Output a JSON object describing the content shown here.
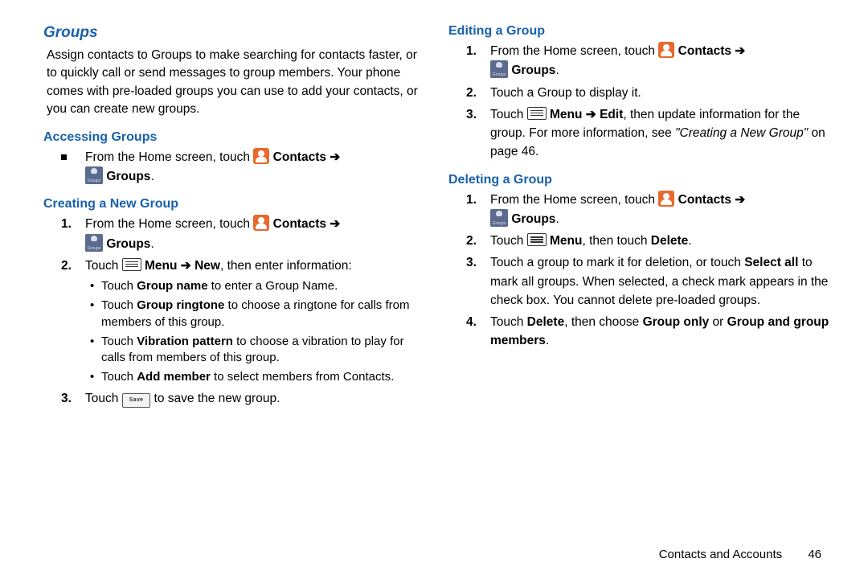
{
  "section_title": "Groups",
  "intro": "Assign contacts to Groups to make searching for contacts faster, or to quickly call or send messages to group members. Your phone comes with pre-loaded groups you can use to add your contacts, or you can create new groups.",
  "labels": {
    "contacts": "Contacts",
    "groups": "Groups",
    "menu": "Menu",
    "new": "New",
    "edit": "Edit",
    "delete": "Delete",
    "save": "Save",
    "select_all": "Select all",
    "group_only": "Group only",
    "group_and_members": "Group and group members",
    "group_name": "Group name",
    "group_ringtone": "Group ringtone",
    "vibration_pattern": "Vibration pattern",
    "add_member": "Add member",
    "arrow": "➔"
  },
  "accessing": {
    "heading": "Accessing Groups",
    "step_pre": "From the Home screen, touch "
  },
  "creating": {
    "heading": "Creating a New Group",
    "s1_pre": "From the Home screen, touch ",
    "s2_pre": "Touch ",
    "s2_post": ", then enter information:",
    "b1_post": " to enter a Group Name.",
    "b2_post": " to choose a ringtone for calls from members of this group.",
    "b3_post": " to choose a vibration to play for calls from members of this group.",
    "b4_post": " to select members from Contacts.",
    "s3_pre": "Touch ",
    "s3_post": " to save the new group."
  },
  "editing": {
    "heading": "Editing a Group",
    "s1_pre": "From the Home screen, touch ",
    "s2": "Touch a Group to display it.",
    "s3_pre": "Touch ",
    "s3_mid": ", then update information for the group. For more information, see ",
    "s3_ref": "\"Creating a New Group\"",
    "s3_post": " on page 46."
  },
  "deleting": {
    "heading": "Deleting a Group",
    "s1_pre": "From the Home screen, touch ",
    "s2_pre": "Touch ",
    "s2_mid": ", then touch ",
    "s3_pre": "Touch a group to mark it for deletion, or touch ",
    "s3_post": " to mark all groups. When selected, a check mark appears in the check box. You cannot delete pre-loaded groups.",
    "s4_pre": "Touch ",
    "s4_mid": ", then choose ",
    "s4_or": " or "
  },
  "touch_word": "Touch ",
  "period": ".",
  "footer": {
    "section": "Contacts and Accounts",
    "page": "46"
  }
}
